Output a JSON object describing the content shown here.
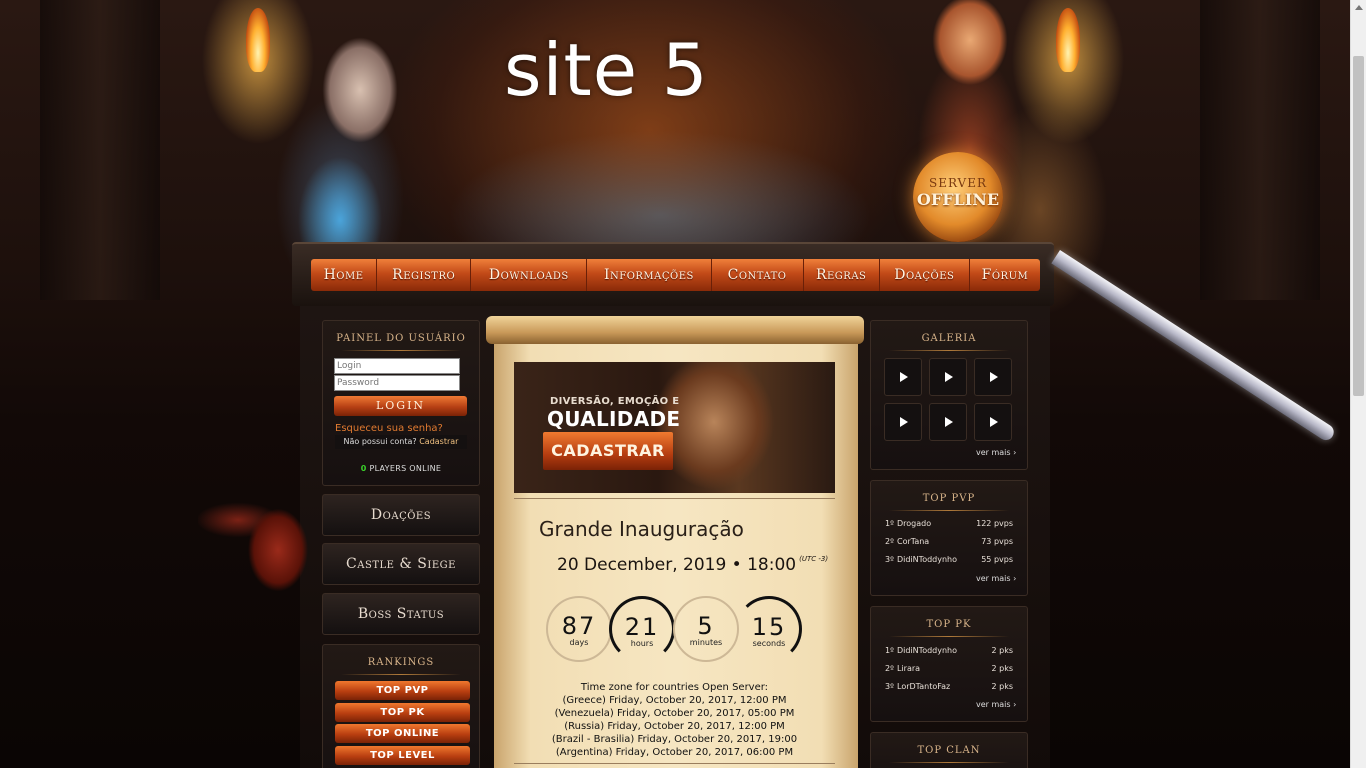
{
  "site_title": "site 5",
  "server_status": {
    "line1": "SERVER",
    "line2": "OFFLINE"
  },
  "nav": [
    "Home",
    "Registro",
    "Downloads",
    "Informações",
    "Contato",
    "Regras",
    "Doações",
    "Fórum"
  ],
  "user_panel": {
    "title": "PAINEL DO USUÁRIO",
    "login_placeholder": "Login",
    "password_placeholder": "Password",
    "login_button": "LOGIN",
    "forgot": "Esqueceu sua senha?",
    "no_account": "Não possui conta?",
    "register_link": "Cadastrar",
    "players_count": "0",
    "players_label": "PLAYERS ONLINE"
  },
  "side_buttons": [
    "Doações",
    "Castle & Siege",
    "Boss Status"
  ],
  "rankings": {
    "title": "RANKINGS",
    "items": [
      "TOP PVP",
      "TOP PK",
      "TOP ONLINE",
      "TOP LEVEL"
    ]
  },
  "banner": {
    "line1": "DIVERSÃO, EMOÇÃO E",
    "line2": "QUALIDADE",
    "button": "CADASTRAR"
  },
  "event": {
    "title": "Grande Inauguração",
    "date": "20 December, 2019 • 18:00",
    "utc": "(UTC -3)",
    "countdown": [
      {
        "value": "87",
        "unit": "days"
      },
      {
        "value": "21",
        "unit": "hours"
      },
      {
        "value": "5",
        "unit": "minutes"
      },
      {
        "value": "15",
        "unit": "seconds"
      }
    ],
    "tz_header": "Time zone for countries Open Server:",
    "tz_lines": [
      "(Greece) Friday, October 20, 2017, 12:00 PM",
      "(Venezuela) Friday, October 20, 2017, 05:00 PM",
      "(Russia) Friday, October 20, 2017, 12:00 PM",
      "(Brazil - Brasilia) Friday, October 20, 2017, 19:00",
      "(Argentina) Friday, October 20, 2017, 06:00 PM"
    ]
  },
  "gallery": {
    "title": "GALERIA",
    "ver_mais": "ver mais ›"
  },
  "top_pvp": {
    "title": "TOP PVP",
    "rows": [
      {
        "rank": "1º",
        "name": "Drogado",
        "value": "122 pvps"
      },
      {
        "rank": "2º",
        "name": "CorTana",
        "value": "73 pvps"
      },
      {
        "rank": "3º",
        "name": "DidiNToddynho",
        "value": "55 pvps"
      }
    ],
    "ver_mais": "ver mais ›"
  },
  "top_pk": {
    "title": "TOP PK",
    "rows": [
      {
        "rank": "1º",
        "name": "DidiNToddynho",
        "value": "2 pks"
      },
      {
        "rank": "2º",
        "name": "Lirara",
        "value": "2 pks"
      },
      {
        "rank": "3º",
        "name": "LorDTantoFaz",
        "value": "2 pks"
      }
    ],
    "ver_mais": "ver mais ›"
  },
  "top_clan": {
    "title": "TOP CLAN"
  }
}
